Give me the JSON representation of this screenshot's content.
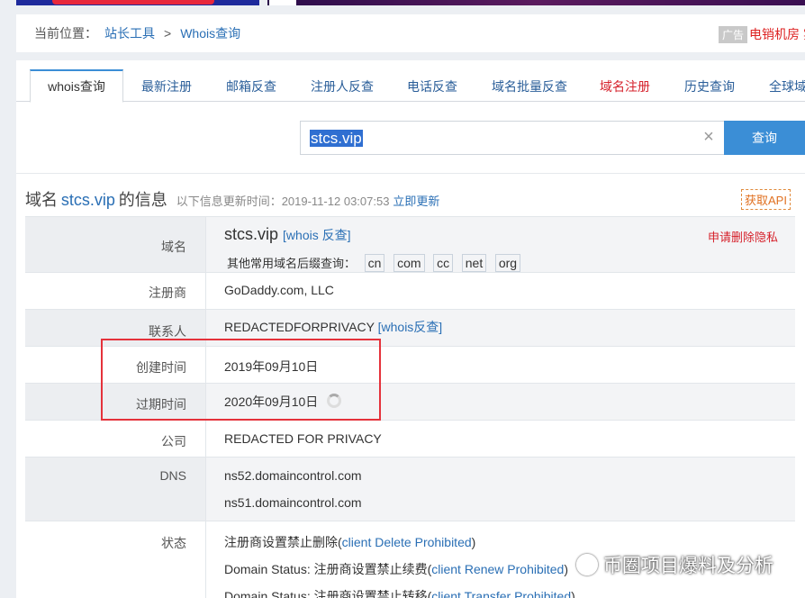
{
  "breadcrumb": {
    "label": "当前位置：",
    "items": [
      "站长工具",
      "Whois查询"
    ],
    "separator": ">",
    "ad_badge": "广告",
    "ad_text": "电销机房 实"
  },
  "tabs": [
    {
      "label": "whois查询",
      "active": true
    },
    {
      "label": "最新注册"
    },
    {
      "label": "邮箱反查"
    },
    {
      "label": "注册人反查"
    },
    {
      "label": "电话反查"
    },
    {
      "label": "域名批量反查"
    },
    {
      "label": "域名注册"
    },
    {
      "label": "历史查询"
    },
    {
      "label": "全球域"
    }
  ],
  "search": {
    "value": "stcs.vip",
    "clear_icon": "×",
    "button": "查询"
  },
  "info": {
    "title_prefix": "域名",
    "domain": "stcs.vip",
    "title_suffix": "的信息",
    "update_note": "以下信息更新时间：2019-11-12 03:07:53",
    "update_link": "立即更新",
    "api_button": "获取API"
  },
  "rows": {
    "domain": {
      "key": "域名",
      "value": "stcs.vip",
      "link": "[whois 反查]",
      "delete_privacy": "申请删除隐私",
      "suffix_label": "其他常用域名后缀查询：",
      "suffixes": [
        "cn",
        "com",
        "cc",
        "net",
        "org"
      ]
    },
    "registrar": {
      "key": "注册商",
      "value": "GoDaddy.com, LLC"
    },
    "contact": {
      "key": "联系人",
      "value": "REDACTEDFORPRIVACY",
      "link": "[whois反查]"
    },
    "created": {
      "key": "创建时间",
      "value": "2019年09月10日"
    },
    "expires": {
      "key": "过期时间",
      "value": "2020年09月10日"
    },
    "company": {
      "key": "公司",
      "value": "REDACTED FOR PRIVACY"
    },
    "dns": {
      "key": "DNS",
      "values": [
        "ns52.domaincontrol.com",
        "ns51.domaincontrol.com"
      ]
    },
    "status": {
      "key": "状态",
      "lines": [
        {
          "text": "注册商设置禁止删除(",
          "link": "client Delete Prohibited",
          "end": ")"
        },
        {
          "text": "Domain Status: 注册商设置禁止续费(",
          "link": "client Renew Prohibited",
          "end": ")"
        },
        {
          "text": "Domain Status: 注册商设置禁止转移(",
          "link": "client Transfer Prohibited",
          "end": ")"
        }
      ]
    }
  },
  "watermark": "币圈项目爆料及分析",
  "colors": {
    "accent": "#3b8ed6",
    "link": "#2a6fb5",
    "highlight_box": "#e5323b",
    "red_text": "#d6212b"
  }
}
